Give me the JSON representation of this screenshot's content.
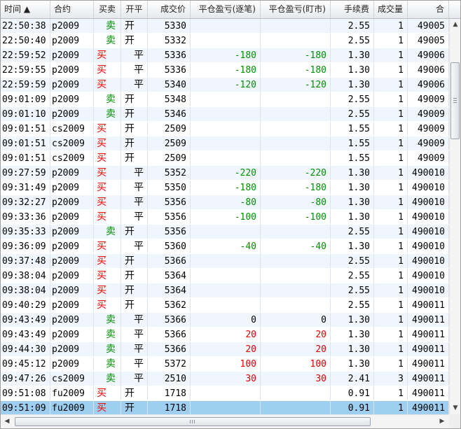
{
  "headers": [
    "时间 ▲",
    "合约",
    "买卖",
    "开平",
    "成交价",
    "平仓盈亏(逐笔)",
    "平仓盈亏(盯市)",
    "手续费",
    "成交量",
    "合"
  ],
  "rows": [
    {
      "time": "22:50:38",
      "contract": "p2009",
      "side": "卖",
      "oc": "开",
      "price": "5330",
      "pnl1": "",
      "pnl2": "",
      "fee": "2.55",
      "vol": "1",
      "id": "49005"
    },
    {
      "time": "22:50:40",
      "contract": "p2009",
      "side": "卖",
      "oc": "开",
      "price": "5332",
      "pnl1": "",
      "pnl2": "",
      "fee": "2.55",
      "vol": "1",
      "id": "49005"
    },
    {
      "time": "22:59:52",
      "contract": "p2009",
      "side": "买",
      "oc": "平",
      "price": "5336",
      "pnl1": "-180",
      "pnl2": "-180",
      "fee": "1.30",
      "vol": "1",
      "id": "49006"
    },
    {
      "time": "22:59:55",
      "contract": "p2009",
      "side": "买",
      "oc": "平",
      "price": "5336",
      "pnl1": "-180",
      "pnl2": "-180",
      "fee": "1.30",
      "vol": "1",
      "id": "49006"
    },
    {
      "time": "22:59:59",
      "contract": "p2009",
      "side": "买",
      "oc": "平",
      "price": "5340",
      "pnl1": "-120",
      "pnl2": "-120",
      "fee": "1.30",
      "vol": "1",
      "id": "49006"
    },
    {
      "time": "09:01:09",
      "contract": "p2009",
      "side": "卖",
      "oc": "开",
      "price": "5348",
      "pnl1": "",
      "pnl2": "",
      "fee": "2.55",
      "vol": "1",
      "id": "49009"
    },
    {
      "time": "09:01:10",
      "contract": "p2009",
      "side": "卖",
      "oc": "开",
      "price": "5346",
      "pnl1": "",
      "pnl2": "",
      "fee": "2.55",
      "vol": "1",
      "id": "49009"
    },
    {
      "time": "09:01:51",
      "contract": "cs2009",
      "side": "买",
      "oc": "开",
      "price": "2509",
      "pnl1": "",
      "pnl2": "",
      "fee": "1.55",
      "vol": "1",
      "id": "49009"
    },
    {
      "time": "09:01:51",
      "contract": "cs2009",
      "side": "买",
      "oc": "开",
      "price": "2509",
      "pnl1": "",
      "pnl2": "",
      "fee": "1.55",
      "vol": "1",
      "id": "49009"
    },
    {
      "time": "09:01:51",
      "contract": "cs2009",
      "side": "买",
      "oc": "开",
      "price": "2509",
      "pnl1": "",
      "pnl2": "",
      "fee": "1.55",
      "vol": "1",
      "id": "49009"
    },
    {
      "time": "09:27:59",
      "contract": "p2009",
      "side": "买",
      "oc": "平",
      "price": "5352",
      "pnl1": "-220",
      "pnl2": "-220",
      "fee": "1.30",
      "vol": "1",
      "id": "490010"
    },
    {
      "time": "09:31:49",
      "contract": "p2009",
      "side": "买",
      "oc": "平",
      "price": "5350",
      "pnl1": "-180",
      "pnl2": "-180",
      "fee": "1.30",
      "vol": "1",
      "id": "490010"
    },
    {
      "time": "09:32:27",
      "contract": "p2009",
      "side": "买",
      "oc": "平",
      "price": "5356",
      "pnl1": "-80",
      "pnl2": "-80",
      "fee": "1.30",
      "vol": "1",
      "id": "490010"
    },
    {
      "time": "09:33:36",
      "contract": "p2009",
      "side": "买",
      "oc": "平",
      "price": "5356",
      "pnl1": "-100",
      "pnl2": "-100",
      "fee": "1.30",
      "vol": "1",
      "id": "490010"
    },
    {
      "time": "09:35:33",
      "contract": "p2009",
      "side": "卖",
      "oc": "开",
      "price": "5356",
      "pnl1": "",
      "pnl2": "",
      "fee": "2.55",
      "vol": "1",
      "id": "490010"
    },
    {
      "time": "09:36:09",
      "contract": "p2009",
      "side": "买",
      "oc": "平",
      "price": "5360",
      "pnl1": "-40",
      "pnl2": "-40",
      "fee": "1.30",
      "vol": "1",
      "id": "490010"
    },
    {
      "time": "09:37:48",
      "contract": "p2009",
      "side": "买",
      "oc": "开",
      "price": "5366",
      "pnl1": "",
      "pnl2": "",
      "fee": "2.55",
      "vol": "1",
      "id": "490010"
    },
    {
      "time": "09:38:04",
      "contract": "p2009",
      "side": "买",
      "oc": "开",
      "price": "5364",
      "pnl1": "",
      "pnl2": "",
      "fee": "2.55",
      "vol": "1",
      "id": "490010"
    },
    {
      "time": "09:38:04",
      "contract": "p2009",
      "side": "买",
      "oc": "开",
      "price": "5364",
      "pnl1": "",
      "pnl2": "",
      "fee": "2.55",
      "vol": "1",
      "id": "490010"
    },
    {
      "time": "09:40:29",
      "contract": "p2009",
      "side": "买",
      "oc": "开",
      "price": "5362",
      "pnl1": "",
      "pnl2": "",
      "fee": "2.55",
      "vol": "1",
      "id": "490011"
    },
    {
      "time": "09:43:49",
      "contract": "p2009",
      "side": "卖",
      "oc": "平",
      "price": "5366",
      "pnl1": "0",
      "pnl2": "0",
      "fee": "1.30",
      "vol": "1",
      "id": "490011"
    },
    {
      "time": "09:43:49",
      "contract": "p2009",
      "side": "卖",
      "oc": "平",
      "price": "5366",
      "pnl1": "20",
      "pnl2": "20",
      "fee": "1.30",
      "vol": "1",
      "id": "490011"
    },
    {
      "time": "09:44:30",
      "contract": "p2009",
      "side": "卖",
      "oc": "平",
      "price": "5366",
      "pnl1": "20",
      "pnl2": "20",
      "fee": "1.30",
      "vol": "1",
      "id": "490011"
    },
    {
      "time": "09:45:12",
      "contract": "p2009",
      "side": "卖",
      "oc": "平",
      "price": "5372",
      "pnl1": "100",
      "pnl2": "100",
      "fee": "1.30",
      "vol": "1",
      "id": "490011"
    },
    {
      "time": "09:47:26",
      "contract": "cs2009",
      "side": "卖",
      "oc": "平",
      "price": "2510",
      "pnl1": "30",
      "pnl2": "30",
      "fee": "2.41",
      "vol": "3",
      "id": "490011"
    },
    {
      "time": "09:51:08",
      "contract": "fu2009",
      "side": "买",
      "oc": "开",
      "price": "1718",
      "pnl1": "",
      "pnl2": "",
      "fee": "0.91",
      "vol": "1",
      "id": "490011"
    },
    {
      "time": "09:51:09",
      "contract": "fu2009",
      "side": "买",
      "oc": "开",
      "price": "1718",
      "pnl1": "",
      "pnl2": "",
      "fee": "0.91",
      "vol": "1",
      "id": "490011"
    }
  ],
  "selected_row": 26,
  "icons": {
    "scroll_up": "arrow-up-icon",
    "scroll_down": "arrow-down-icon",
    "scroll_left": "arrow-left-icon",
    "scroll_right": "arrow-right-icon"
  },
  "scroll": {
    "up": "▲",
    "down": "▼",
    "left": "◀",
    "right": "▶"
  },
  "colors": {
    "buy": "#ff0000",
    "sell": "#009000",
    "profit": "#e00000",
    "loss": "#009000",
    "selection": "#9fcff0"
  }
}
